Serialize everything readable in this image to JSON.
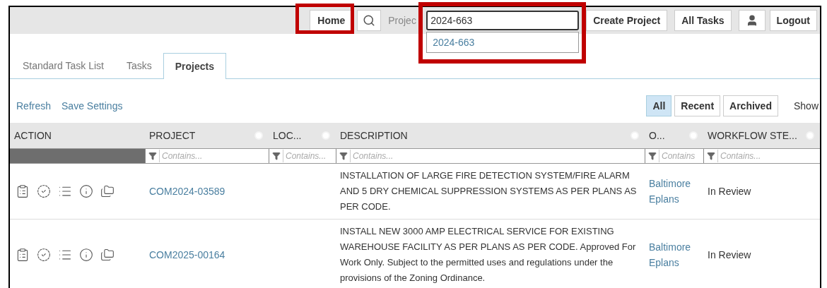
{
  "top_bar": {
    "home_button": "Home",
    "project_label": "Projec",
    "project_search": {
      "value": "2024-663",
      "suggestions": [
        "2024-663"
      ]
    },
    "buttons": [
      "Create Project",
      "All Tasks"
    ],
    "logout_button": "Logout"
  },
  "tabs": [
    {
      "label": "Standard Task List",
      "selected": false
    },
    {
      "label": "Tasks",
      "selected": false
    },
    {
      "label": "Projects",
      "selected": true
    }
  ],
  "toolbar": {
    "links": [
      "Refresh",
      "Save Settings"
    ],
    "filters": [
      {
        "label": "All",
        "selected": true
      },
      {
        "label": "Recent",
        "selected": false
      },
      {
        "label": "Archived",
        "selected": false
      }
    ],
    "show_label": "Show"
  },
  "table": {
    "columns": [
      {
        "label": "ACTION"
      },
      {
        "label": "PROJECT",
        "filter": "Contains..."
      },
      {
        "label": "LOC...",
        "filter": "Contains..."
      },
      {
        "label": "DESCRIPTION",
        "filter": "Contains..."
      },
      {
        "label": "O...",
        "filter": "Contains"
      },
      {
        "label": "WORKFLOW STE...",
        "filter": "Contains..."
      }
    ],
    "rows": [
      {
        "project": "COM2024-03589",
        "description": "INSTALLATION OF LARGE FIRE DETECTION SYSTEM/FIRE ALARM AND 5 DRY CHEMICAL SUPPRESSION SYSTEMS AS PER PLANS AS PER CODE.",
        "owner": "Baltimore Eplans",
        "workflow_step": "In Review"
      },
      {
        "project": "COM2025-00164",
        "description": "INSTALL NEW 3000 AMP ELECTRICAL SERVICE FOR EXISTING WAREHOUSE FACILITY AS PER PLANS AS PER CODE. Approved For Work Only. Subject to the permitted uses and regulations under the provisions of the Zoning Ordinance.",
        "owner": "Baltimore Eplans",
        "workflow_step": "In Review"
      }
    ]
  }
}
